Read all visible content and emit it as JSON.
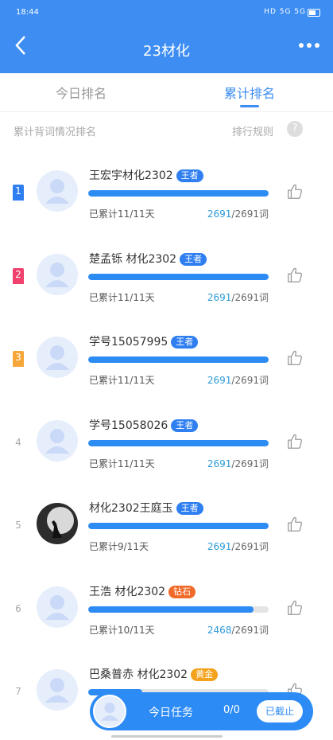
{
  "status": {
    "time": "18:44",
    "icons": "HD 5G 5G",
    "battery": "31%"
  },
  "header": {
    "title": "23材化",
    "back_icon": "chevron-left-icon",
    "more_icon": "more-dots-icon"
  },
  "tabs": [
    {
      "label": "今日排名",
      "active": false
    },
    {
      "label": "累计排名",
      "active": true
    }
  ],
  "subheader": {
    "left": "累计背词情况排名",
    "rule": "排行规则",
    "help": "?"
  },
  "rows": [
    {
      "rank": "1",
      "name": "王宏宇材化2302",
      "badge": "王者",
      "badge_color": "#2f7ff0",
      "days": "已累计11/11天",
      "done": "2691",
      "total": "/2691词",
      "progress": 1.0
    },
    {
      "rank": "2",
      "name": "楚孟铄 材化2302",
      "badge": "王者",
      "badge_color": "#2f7ff0",
      "days": "已累计11/11天",
      "done": "2691",
      "total": "/2691词",
      "progress": 1.0
    },
    {
      "rank": "3",
      "name": "学号15057995",
      "badge": "王者",
      "badge_color": "#2f7ff0",
      "days": "已累计11/11天",
      "done": "2691",
      "total": "/2691词",
      "progress": 1.0
    },
    {
      "rank": "4",
      "name": "学号15058026",
      "badge": "王者",
      "badge_color": "#2f7ff0",
      "days": "已累计11/11天",
      "done": "2691",
      "total": "/2691词",
      "progress": 1.0
    },
    {
      "rank": "5",
      "name": "材化2302王庭玉",
      "badge": "王者",
      "badge_color": "#2f7ff0",
      "days": "已累计9/11天",
      "done": "2691",
      "total": "/2691词",
      "progress": 1.0
    },
    {
      "rank": "6",
      "name": "王浩 材化2302",
      "badge": "钻石",
      "badge_color": "#f06a2a",
      "days": "已累计10/11天",
      "done": "2468",
      "total": "/2691词",
      "progress": 0.917
    },
    {
      "rank": "7",
      "name": "巴桑普赤 材化2302",
      "badge": "黄金",
      "badge_color": "#f3a21c",
      "days": "",
      "done": "",
      "total": "",
      "progress": 0.3
    }
  ],
  "rank_flag_colors": [
    "#2f7ff0",
    "#f2416c",
    "#f7a63a"
  ],
  "bottom": {
    "task_label": "今日任务",
    "progress": "0/0",
    "deadline": "已截止"
  }
}
